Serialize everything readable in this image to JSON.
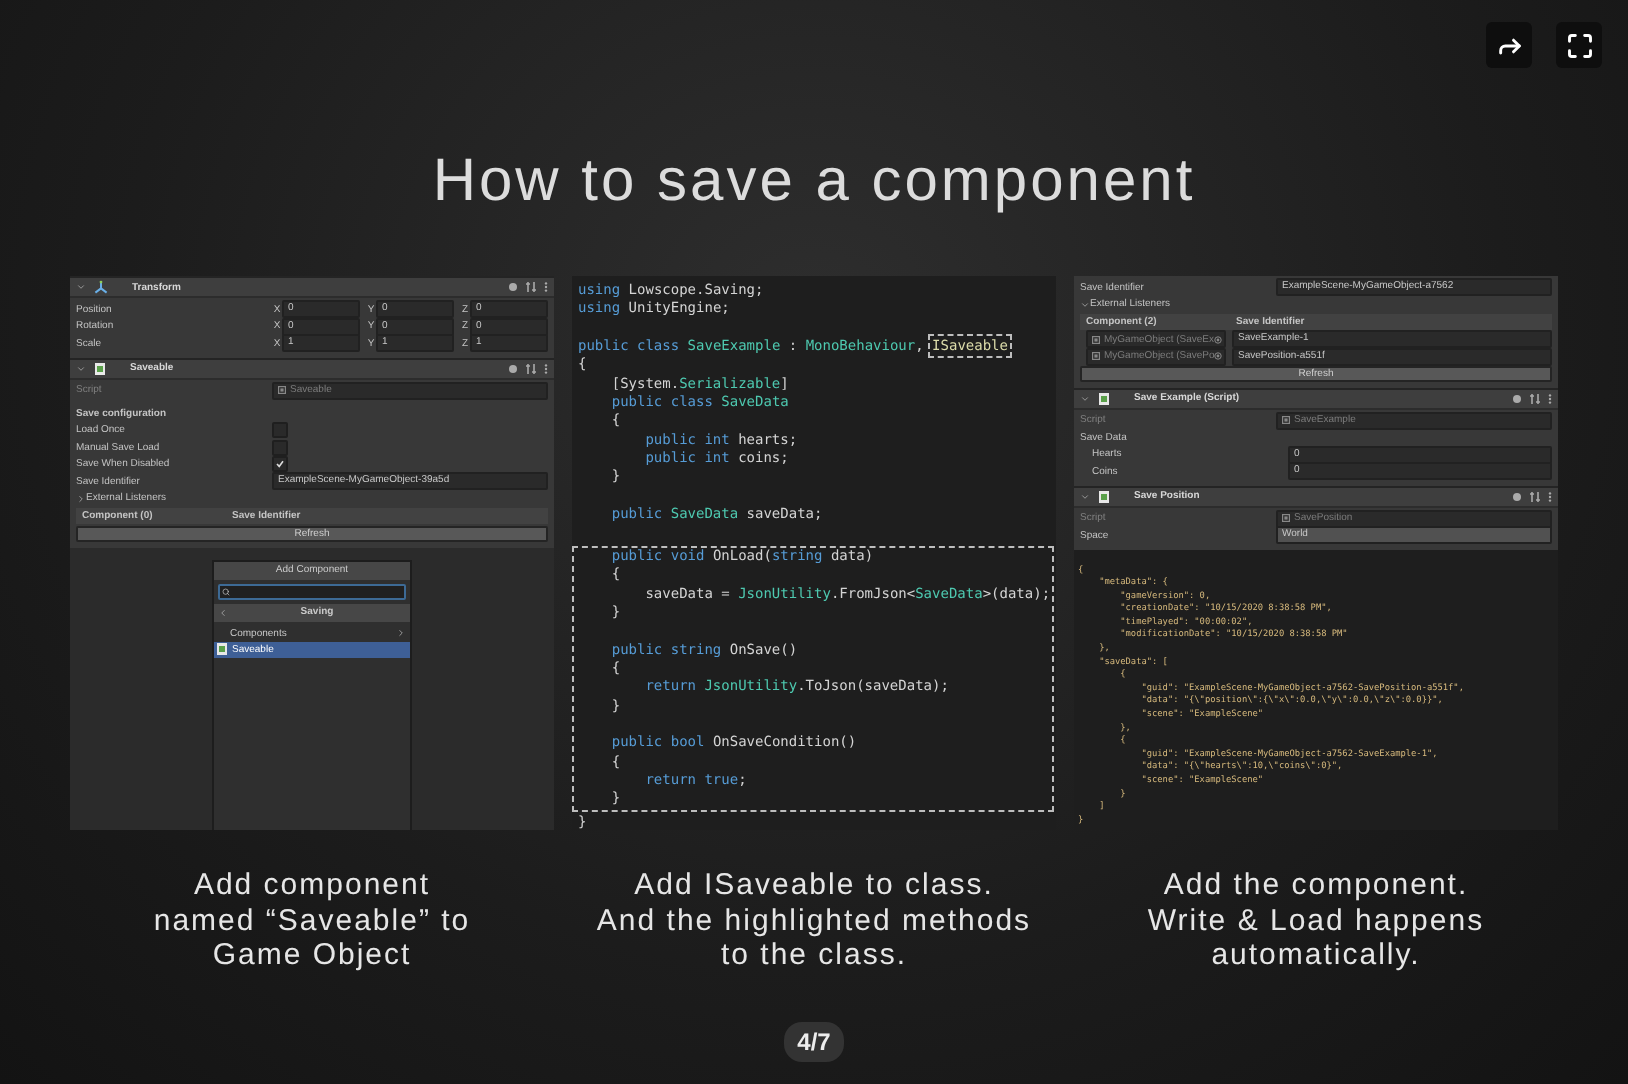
{
  "title": "How to save a component",
  "panels": [
    {
      "kind": "inspector",
      "components": [
        {
          "title": "Transform",
          "kind": "transform",
          "rows": [
            {
              "kind": "vector3",
              "label": "Position",
              "axes": [
                {
                  "axis": "X",
                  "value": "0"
                },
                {
                  "axis": "Y",
                  "value": "0"
                },
                {
                  "axis": "Z",
                  "value": "0"
                }
              ]
            },
            {
              "kind": "vector3",
              "label": "Rotation",
              "axes": [
                {
                  "axis": "X",
                  "value": "0"
                },
                {
                  "axis": "Y",
                  "value": "0"
                },
                {
                  "axis": "Z",
                  "value": "0"
                }
              ]
            },
            {
              "kind": "vector3",
              "label": "Scale",
              "axes": [
                {
                  "axis": "X",
                  "value": "1"
                },
                {
                  "axis": "Y",
                  "value": "1"
                },
                {
                  "axis": "Z",
                  "value": "1"
                }
              ]
            }
          ]
        },
        {
          "title": "Saveable",
          "kind": "script",
          "rows": [
            {
              "kind": "object",
              "label": "Script",
              "value": "Saveable",
              "disabled": true
            },
            {
              "kind": "heading",
              "label": "Save configuration"
            },
            {
              "kind": "checkbox",
              "label": "Load Once",
              "checked": false
            },
            {
              "kind": "checkbox",
              "label": "Manual Save Load",
              "checked": false
            },
            {
              "kind": "checkbox",
              "label": "Save When Disabled",
              "checked": true
            },
            {
              "kind": "text",
              "label": "Save Identifier",
              "value": "ExampleScene-MyGameObject-39a5d"
            },
            {
              "kind": "foldout",
              "label": "External Listeners",
              "expanded": false
            },
            {
              "kind": "table_header",
              "columns": [
                "Component (0)",
                "Save Identifier"
              ]
            },
            {
              "kind": "button",
              "label": "Refresh"
            }
          ]
        }
      ],
      "popup": {
        "title": "Add Component",
        "section": "Saving",
        "items": [
          {
            "kind": "folder",
            "label": "Components",
            "selected": false
          },
          {
            "kind": "script",
            "label": "Saveable",
            "selected": true
          }
        ]
      }
    },
    {
      "kind": "code",
      "blocks": [
        {
          "highlighted": false,
          "lines": [
            {
              "kind": "code",
              "segments": [
                {
                  "kind": "keyword",
                  "text": "using "
                },
                {
                  "kind": "plain",
                  "text": "Lowscope.Saving;"
                }
              ]
            },
            {
              "kind": "code",
              "segments": [
                {
                  "kind": "keyword",
                  "text": "using "
                },
                {
                  "kind": "plain",
                  "text": "UnityEngine;"
                }
              ]
            },
            {
              "kind": "blank"
            },
            {
              "kind": "code",
              "segments": [
                {
                  "kind": "keyword",
                  "text": "public class "
                },
                {
                  "kind": "type",
                  "text": "SaveExample"
                },
                {
                  "kind": "plain",
                  "text": " : "
                },
                {
                  "kind": "type",
                  "text": "MonoBehaviour"
                },
                {
                  "kind": "plain",
                  "text": ", "
                },
                {
                  "kind": "highlight",
                  "text": "ISaveable"
                }
              ]
            },
            {
              "kind": "code",
              "segments": [
                {
                  "kind": "plain",
                  "text": "{"
                }
              ]
            },
            {
              "kind": "code",
              "segments": [
                {
                  "kind": "plain",
                  "text": "    [System."
                },
                {
                  "kind": "type",
                  "text": "Serializable"
                },
                {
                  "kind": "plain",
                  "text": "]"
                }
              ]
            },
            {
              "kind": "code",
              "segments": [
                {
                  "kind": "keyword",
                  "text": "    public class "
                },
                {
                  "kind": "type",
                  "text": "SaveData"
                }
              ]
            },
            {
              "kind": "code",
              "segments": [
                {
                  "kind": "plain",
                  "text": "    {"
                }
              ]
            },
            {
              "kind": "code",
              "segments": [
                {
                  "kind": "keyword",
                  "text": "        public int "
                },
                {
                  "kind": "plain",
                  "text": "hearts;"
                }
              ]
            },
            {
              "kind": "code",
              "segments": [
                {
                  "kind": "keyword",
                  "text": "        public int "
                },
                {
                  "kind": "plain",
                  "text": "coins;"
                }
              ]
            },
            {
              "kind": "code",
              "segments": [
                {
                  "kind": "plain",
                  "text": "    }"
                }
              ]
            },
            {
              "kind": "blank"
            },
            {
              "kind": "code",
              "segments": [
                {
                  "kind": "keyword",
                  "text": "    public "
                },
                {
                  "kind": "type",
                  "text": "SaveData"
                },
                {
                  "kind": "plain",
                  "text": " saveData;"
                }
              ]
            },
            {
              "kind": "blank"
            }
          ]
        },
        {
          "highlighted": true,
          "lines": [
            {
              "kind": "code",
              "segments": [
                {
                  "kind": "keyword",
                  "text": "    public void "
                },
                {
                  "kind": "plain",
                  "text": "OnLoad("
                },
                {
                  "kind": "keyword",
                  "text": "string"
                },
                {
                  "kind": "plain",
                  "text": " data)"
                }
              ]
            },
            {
              "kind": "code",
              "segments": [
                {
                  "kind": "plain",
                  "text": "    {"
                }
              ]
            },
            {
              "kind": "code",
              "segments": [
                {
                  "kind": "plain",
                  "text": "        saveData = "
                },
                {
                  "kind": "type",
                  "text": "JsonUtility"
                },
                {
                  "kind": "plain",
                  "text": ".FromJson<"
                },
                {
                  "kind": "type",
                  "text": "SaveData"
                },
                {
                  "kind": "plain",
                  "text": ">(data);"
                }
              ]
            },
            {
              "kind": "code",
              "segments": [
                {
                  "kind": "plain",
                  "text": "    }"
                }
              ]
            },
            {
              "kind": "blank"
            },
            {
              "kind": "code",
              "segments": [
                {
                  "kind": "keyword",
                  "text": "    public string "
                },
                {
                  "kind": "plain",
                  "text": "OnSave()"
                }
              ]
            },
            {
              "kind": "code",
              "segments": [
                {
                  "kind": "plain",
                  "text": "    {"
                }
              ]
            },
            {
              "kind": "code",
              "segments": [
                {
                  "kind": "keyword",
                  "text": "        return "
                },
                {
                  "kind": "type",
                  "text": "JsonUtility"
                },
                {
                  "kind": "plain",
                  "text": ".ToJson(saveData);"
                }
              ]
            },
            {
              "kind": "code",
              "segments": [
                {
                  "kind": "plain",
                  "text": "    }"
                }
              ]
            },
            {
              "kind": "blank"
            },
            {
              "kind": "code",
              "segments": [
                {
                  "kind": "keyword",
                  "text": "    public bool "
                },
                {
                  "kind": "plain",
                  "text": "OnSaveCondition()"
                }
              ]
            },
            {
              "kind": "code",
              "segments": [
                {
                  "kind": "plain",
                  "text": "    {"
                }
              ]
            },
            {
              "kind": "code",
              "segments": [
                {
                  "kind": "keyword",
                  "text": "        return true"
                },
                {
                  "kind": "plain",
                  "text": ";"
                }
              ]
            },
            {
              "kind": "code",
              "segments": [
                {
                  "kind": "plain",
                  "text": "    }"
                }
              ]
            }
          ]
        },
        {
          "highlighted": false,
          "lines": [
            {
              "kind": "code",
              "segments": [
                {
                  "kind": "plain",
                  "text": "}"
                }
              ]
            }
          ]
        }
      ]
    },
    {
      "kind": "inspector",
      "components": [
        {
          "rows": [
            {
              "kind": "text",
              "label": "Save Identifier",
              "value": "ExampleScene-MyGameObject-a7562"
            },
            {
              "kind": "foldout",
              "label": "External Listeners",
              "expanded": true
            },
            {
              "kind": "table_header",
              "columns": [
                "Component (2)",
                "Save Identifier"
              ]
            },
            {
              "kind": "listener",
              "object": "MyGameObject (SaveEx",
              "value": "SaveExample-1"
            },
            {
              "kind": "listener",
              "object": "MyGameObject (SavePo",
              "value": "SavePosition-a551f"
            },
            {
              "kind": "button",
              "label": "Refresh"
            }
          ]
        },
        {
          "title": "Save Example (Script)",
          "kind": "script",
          "rows": [
            {
              "kind": "object",
              "label": "Script",
              "value": "SaveExample",
              "disabled": true
            },
            {
              "kind": "group",
              "label": "Save Data",
              "children": [
                {
                  "kind": "text",
                  "label": "Hearts",
                  "value": "0"
                },
                {
                  "kind": "text",
                  "label": "Coins",
                  "value": "0"
                }
              ]
            }
          ]
        },
        {
          "title": "Save Position",
          "kind": "script",
          "rows": [
            {
              "kind": "object",
              "label": "Script",
              "value": "SavePosition",
              "disabled": true
            },
            {
              "kind": "dropdown",
              "label": "Space",
              "value": "World"
            }
          ]
        }
      ],
      "json_lines": [
        "{",
        "    \"metaData\": {",
        "        \"gameVersion\": 0,",
        "        \"creationDate\": \"10/15/2020 8:38:58 PM\",",
        "        \"timePlayed\": \"00:00:02\",",
        "        \"modificationDate\": \"10/15/2020 8:38:58 PM\"",
        "    },",
        "    \"saveData\": [",
        "        {",
        "            \"guid\": \"ExampleScene-MyGameObject-a7562-SavePosition-a551f\",",
        "            \"data\": \"{\\\"position\\\":{\\\"x\\\":0.0,\\\"y\\\":0.0,\\\"z\\\":0.0}}\",",
        "            \"scene\": \"ExampleScene\"",
        "        },",
        "        {",
        "            \"guid\": \"ExampleScene-MyGameObject-a7562-SaveExample-1\",",
        "            \"data\": \"{\\\"hearts\\\":10,\\\"coins\\\":0}\",",
        "            \"scene\": \"ExampleScene\"",
        "        }",
        "    ]",
        "}"
      ]
    }
  ],
  "captions": [
    "Add component\nnamed “Saveable” to\nGame Object",
    "Add ISaveable to class.\nAnd the highlighted methods\nto the class.",
    "Add the component.\nWrite & Load happens\nautomatically."
  ],
  "pager": "4/7"
}
